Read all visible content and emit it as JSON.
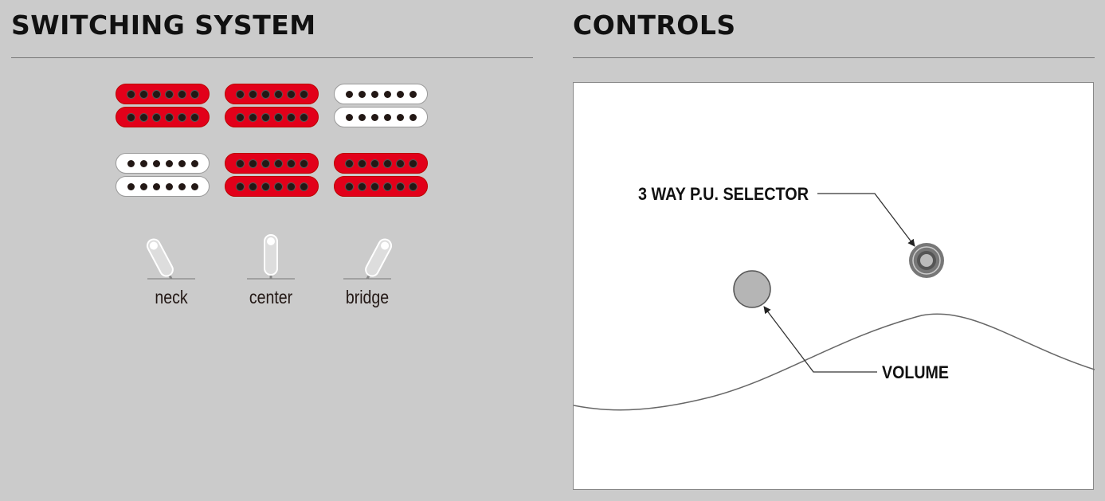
{
  "switching": {
    "title": "SWITCHING SYSTEM",
    "positions": [
      {
        "label": "neck",
        "angle": -28,
        "neck_pickup": "red",
        "bridge_pickup": "white"
      },
      {
        "label": "center",
        "angle": 0,
        "neck_pickup": "red",
        "bridge_pickup": "red"
      },
      {
        "label": "bridge",
        "angle": 28,
        "neck_pickup": "white",
        "bridge_pickup": "red"
      }
    ]
  },
  "controls": {
    "title": "CONTROLS",
    "selector_label": "3 WAY P.U. SELECTOR",
    "volume_label": "VOLUME"
  },
  "colors": {
    "active": "#e2001a",
    "inactive": "#ffffff"
  }
}
